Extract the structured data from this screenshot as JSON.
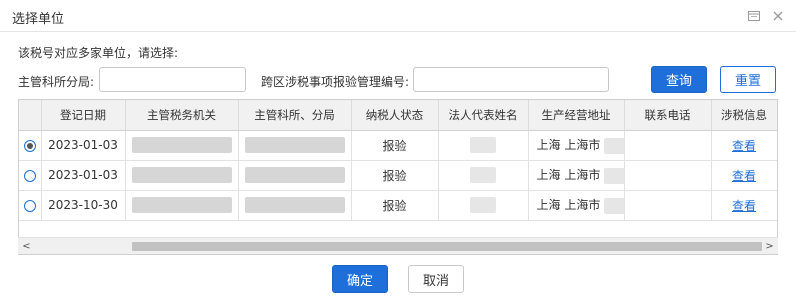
{
  "dialog": {
    "title": "选择单位",
    "maximize_icon": "maximize-icon",
    "close_icon": "close-icon"
  },
  "prompt": "该税号对应多家单位，请选择:",
  "filters": {
    "tax_bureau_label": "主管科所分局:",
    "tax_bureau_value": "",
    "report_no_label": "跨区涉税事项报验管理编号:",
    "report_no_value": "",
    "query_label": "查询",
    "reset_label": "重置"
  },
  "table": {
    "headers": [
      "",
      "登记日期",
      "主管税务机关",
      "主管科所、分局",
      "纳税人状态",
      "法人代表姓名",
      "生产经营地址",
      "联系电话",
      "涉税信息"
    ],
    "rows": [
      {
        "selected": true,
        "date": "2023-01-03",
        "status": "报验",
        "address": "上海 上海市",
        "action": "查看"
      },
      {
        "selected": false,
        "date": "2023-01-03",
        "status": "报验",
        "address": "上海 上海市",
        "action": "查看"
      },
      {
        "selected": false,
        "date": "2023-10-30",
        "status": "报验",
        "address": "上海 上海市",
        "action": "查看"
      }
    ]
  },
  "scrollbar": {
    "left_arrow": "<",
    "right_arrow": ">"
  },
  "footer": {
    "ok_label": "确定",
    "cancel_label": "取消"
  }
}
